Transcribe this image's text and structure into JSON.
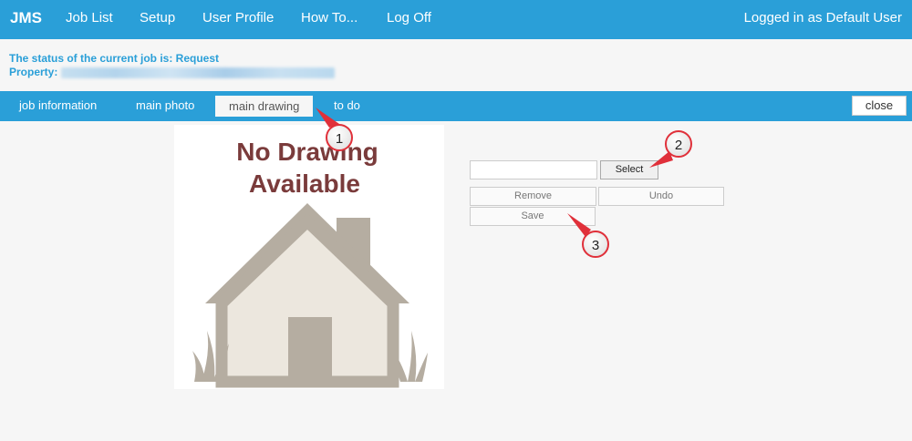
{
  "navbar": {
    "brand": "JMS",
    "links": [
      "Job List",
      "Setup",
      "User Profile",
      "How To...",
      "Log Off"
    ],
    "login_status": "Logged in as Default User"
  },
  "status": {
    "job_status": "The status of the current job is: Request",
    "property_label": "Property:"
  },
  "tabs": [
    "job information",
    "main photo",
    "main drawing",
    "to do"
  ],
  "active_tab": "main drawing",
  "close_label": "close",
  "drawing": {
    "placeholder_line1": "No Drawing",
    "placeholder_line2": "Available",
    "text_color": "#7a3b3b",
    "house_color": "#b5ada1"
  },
  "controls": {
    "file_value": "",
    "select_label": "Select",
    "remove_label": "Remove",
    "undo_label": "Undo",
    "save_label": "Save"
  },
  "callouts": [
    "1",
    "2",
    "3"
  ],
  "colors": {
    "accent": "#2a9fd8",
    "callout_arrow": "#e0303a"
  }
}
